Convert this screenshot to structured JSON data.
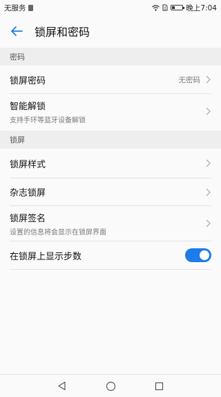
{
  "status_bar": {
    "carrier": "无服务",
    "time": "晚上7:04"
  },
  "header": {
    "title": "锁屏和密码"
  },
  "sections": {
    "password": {
      "title": "密码",
      "items": [
        {
          "title": "锁屏密码",
          "value": "无密码"
        },
        {
          "title": "智能解锁",
          "subtitle": "支持手环等蓝牙设备解锁"
        }
      ]
    },
    "lockscreen": {
      "title": "锁屏",
      "items": [
        {
          "title": "锁屏样式"
        },
        {
          "title": "杂志锁屏"
        },
        {
          "title": "锁屏签名",
          "subtitle": "设置的信息将会显示在锁屏界面"
        },
        {
          "title": "在锁屏上显示步数",
          "toggle_on": true
        }
      ]
    }
  },
  "icons": {
    "back": "back-arrow-icon",
    "chevron": "chevron-right-icon",
    "nav_back": "nav-back-icon",
    "nav_home": "nav-home-icon",
    "nav_recents": "nav-recents-icon"
  },
  "colors": {
    "accent": "#1e7bea",
    "section_bg": "#eeeeee",
    "background": "#fafafa"
  }
}
